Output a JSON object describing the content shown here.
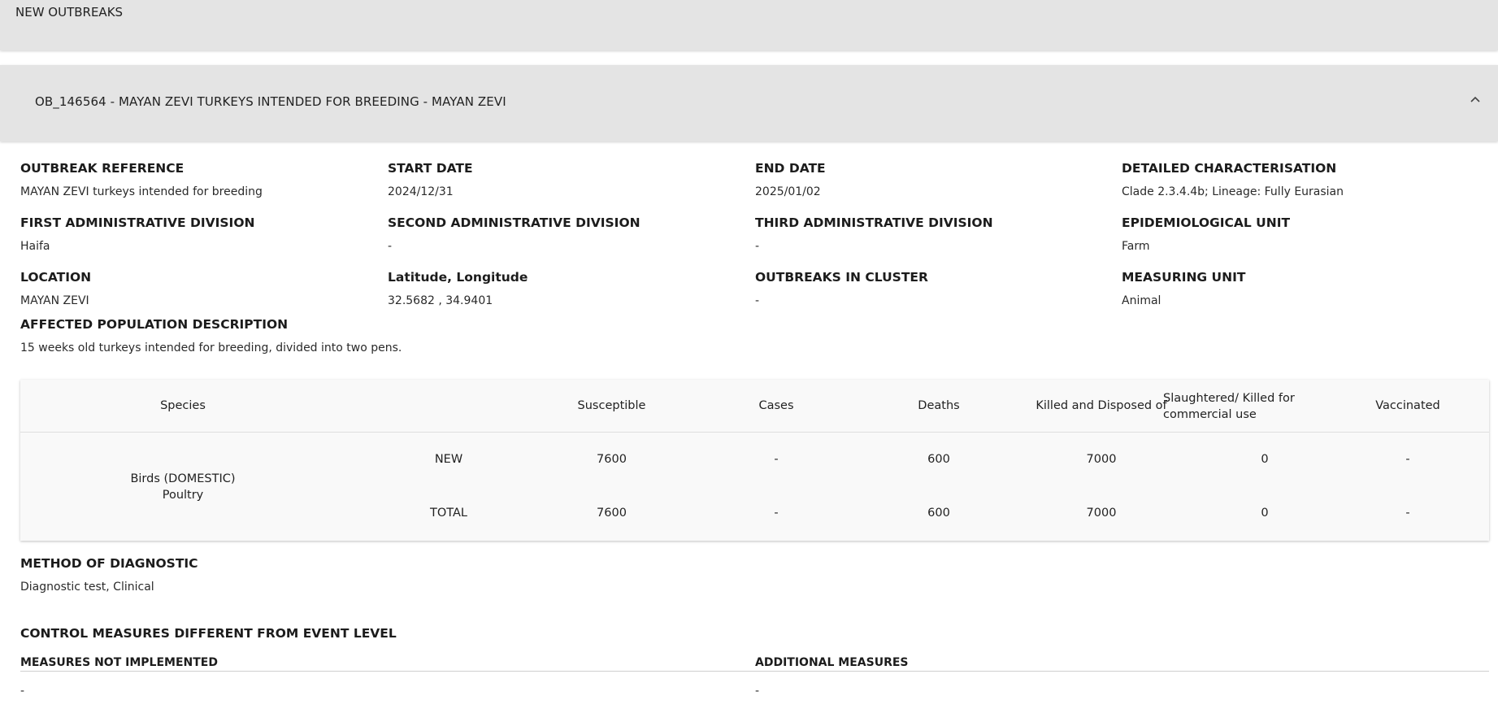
{
  "section": {
    "title": "NEW OUTBREAKS"
  },
  "outbreak": {
    "title": "OB_146564 - MAYAN ZEVI TURKEYS INTENDED FOR BREEDING - MAYAN ZEVI",
    "expanded": true
  },
  "fields": {
    "outbreak_reference": {
      "label": "OUTBREAK REFERENCE",
      "value": "MAYAN ZEVI turkeys intended for breeding"
    },
    "start_date": {
      "label": "START DATE",
      "value": "2024/12/31"
    },
    "end_date": {
      "label": "END DATE",
      "value": "2025/01/02"
    },
    "detailed_characterisation": {
      "label": "DETAILED CHARACTERISATION",
      "value": "Clade 2.3.4.4b; Lineage: Fully Eurasian"
    },
    "first_admin": {
      "label": "FIRST ADMINISTRATIVE DIVISION",
      "value": "Haifa"
    },
    "second_admin": {
      "label": "SECOND ADMINISTRATIVE DIVISION",
      "value": "-"
    },
    "third_admin": {
      "label": "THIRD ADMINISTRATIVE DIVISION",
      "value": "-"
    },
    "epi_unit": {
      "label": "EPIDEMIOLOGICAL UNIT",
      "value": "Farm"
    },
    "location": {
      "label": "LOCATION",
      "value": "MAYAN ZEVI"
    },
    "lat_long": {
      "label": "Latitude, Longitude",
      "value": "32.5682 , 34.9401"
    },
    "outbreaks_in_cluster": {
      "label": "OUTBREAKS IN CLUSTER",
      "value": "-"
    },
    "measuring_unit": {
      "label": "MEASURING UNIT",
      "value": "Animal"
    },
    "affected_population": {
      "label": "AFFECTED POPULATION DESCRIPTION",
      "value": "15 weeks old turkeys intended for breeding, divided into two pens."
    },
    "method_of_diagnostic": {
      "label": "METHOD OF DIAGNOSTIC",
      "value": "Diagnostic test, Clinical"
    }
  },
  "table": {
    "headers": {
      "species": "Species",
      "susceptible": "Susceptible",
      "cases": "Cases",
      "deaths": "Deaths",
      "killed": "Killed and Disposed of",
      "slaughtered_line1": "Slaughtered/ Killed for",
      "slaughtered_line2": "commercial use",
      "vaccinated": "Vaccinated"
    },
    "species_line1": "Birds (DOMESTIC)",
    "species_line2": "Poultry",
    "rows": [
      {
        "type": "NEW",
        "susceptible": "7600",
        "cases": "-",
        "deaths": "600",
        "killed": "7000",
        "slaughtered": "0",
        "vaccinated": "-"
      },
      {
        "type": "TOTAL",
        "susceptible": "7600",
        "cases": "-",
        "deaths": "600",
        "killed": "7000",
        "slaughtered": "0",
        "vaccinated": "-"
      }
    ]
  },
  "control_measures": {
    "title": "CONTROL MEASURES DIFFERENT FROM EVENT LEVEL",
    "not_implemented_label": "MEASURES NOT IMPLEMENTED",
    "not_implemented_value": "-",
    "additional_label": "ADDITIONAL MEASURES",
    "additional_value": "-"
  },
  "icons": {
    "collapse": "chevron-up-icon"
  }
}
